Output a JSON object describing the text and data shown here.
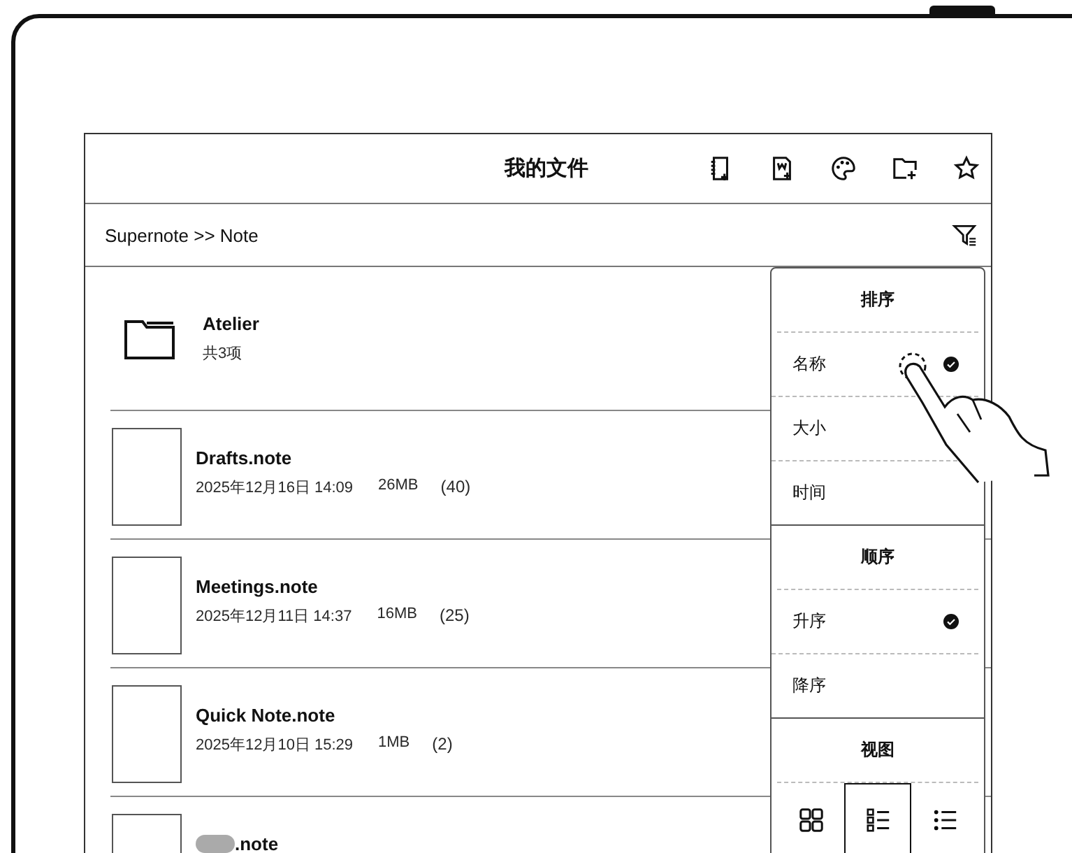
{
  "screen": {
    "title": "我的文件",
    "breadcrumb": "Supernote >> Note",
    "files": [
      {
        "kind": "folder",
        "name": "Atelier",
        "info": "共3项"
      },
      {
        "kind": "note",
        "name": "Drafts.note",
        "date": "2025年12月16日 14:09",
        "size": "26MB",
        "pages": "(40)"
      },
      {
        "kind": "note",
        "name": "Meetings.note",
        "date": "2025年12月11日 14:37",
        "size": "16MB",
        "pages": "(25)"
      },
      {
        "kind": "note",
        "name": "Quick Note.note",
        "date": "2025年12月10日 15:29",
        "size": "1MB",
        "pages": "(2)"
      },
      {
        "kind": "note",
        "name": ".note",
        "redacted": true
      }
    ]
  },
  "sort_menu": {
    "sections": [
      {
        "title": "排序",
        "options": [
          {
            "label": "名称",
            "selected": true
          },
          {
            "label": "大小",
            "selected": false
          },
          {
            "label": "时间",
            "selected": false
          }
        ]
      },
      {
        "title": "顺序",
        "options": [
          {
            "label": "升序",
            "selected": true
          },
          {
            "label": "降序",
            "selected": false
          }
        ]
      },
      {
        "title": "视图",
        "views": [
          {
            "kind": "grid",
            "selected": false
          },
          {
            "kind": "detail",
            "selected": true
          },
          {
            "kind": "list",
            "selected": false
          }
        ]
      }
    ]
  }
}
